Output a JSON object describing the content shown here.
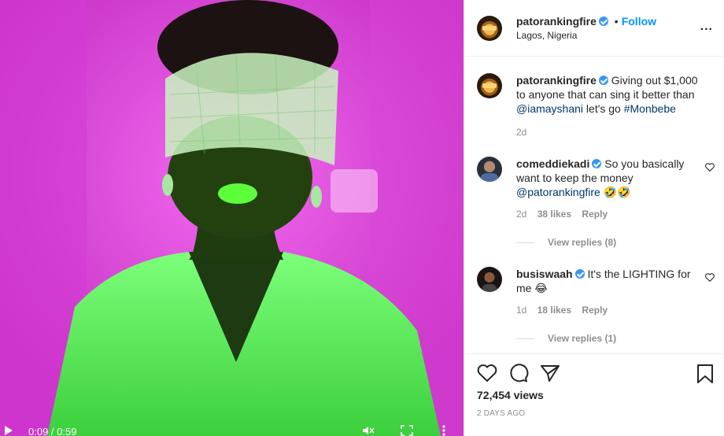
{
  "video": {
    "time": "0:09 / 0:59",
    "background_color": "#e23fe0"
  },
  "header": {
    "username": "patorankingfire",
    "follow_label": "Follow",
    "separator": "•",
    "location": "Lagos, Nigeria",
    "more_label": "..."
  },
  "caption": {
    "username": "patorankingfire",
    "text_1": "Giving out $1,000 to anyone that can sing it better than",
    "mention": "@iamayshani",
    "text_2": "let's go",
    "hashtag": "#Monbebe",
    "age": "2d"
  },
  "comments": [
    {
      "username": "comeddiekadi",
      "text": "So you basically want to keep the money",
      "mention": "@patorankingfire",
      "emoji": "🤣🤣",
      "age": "2d",
      "likes": "38 likes",
      "reply_label": "Reply",
      "view_replies": "View replies (8)"
    },
    {
      "username": "busiswaah",
      "text": "It's the LIGHTING for me",
      "emoji": "😂",
      "age": "1d",
      "likes": "18 likes",
      "reply_label": "Reply",
      "view_replies": "View replies (1)"
    }
  ],
  "footer": {
    "views": "72,454 views",
    "posted": "2 DAYS AGO"
  },
  "colors": {
    "link": "#00376b",
    "follow": "#0095f6",
    "verified": "#3897f0",
    "muted": "#8e8e8e"
  }
}
